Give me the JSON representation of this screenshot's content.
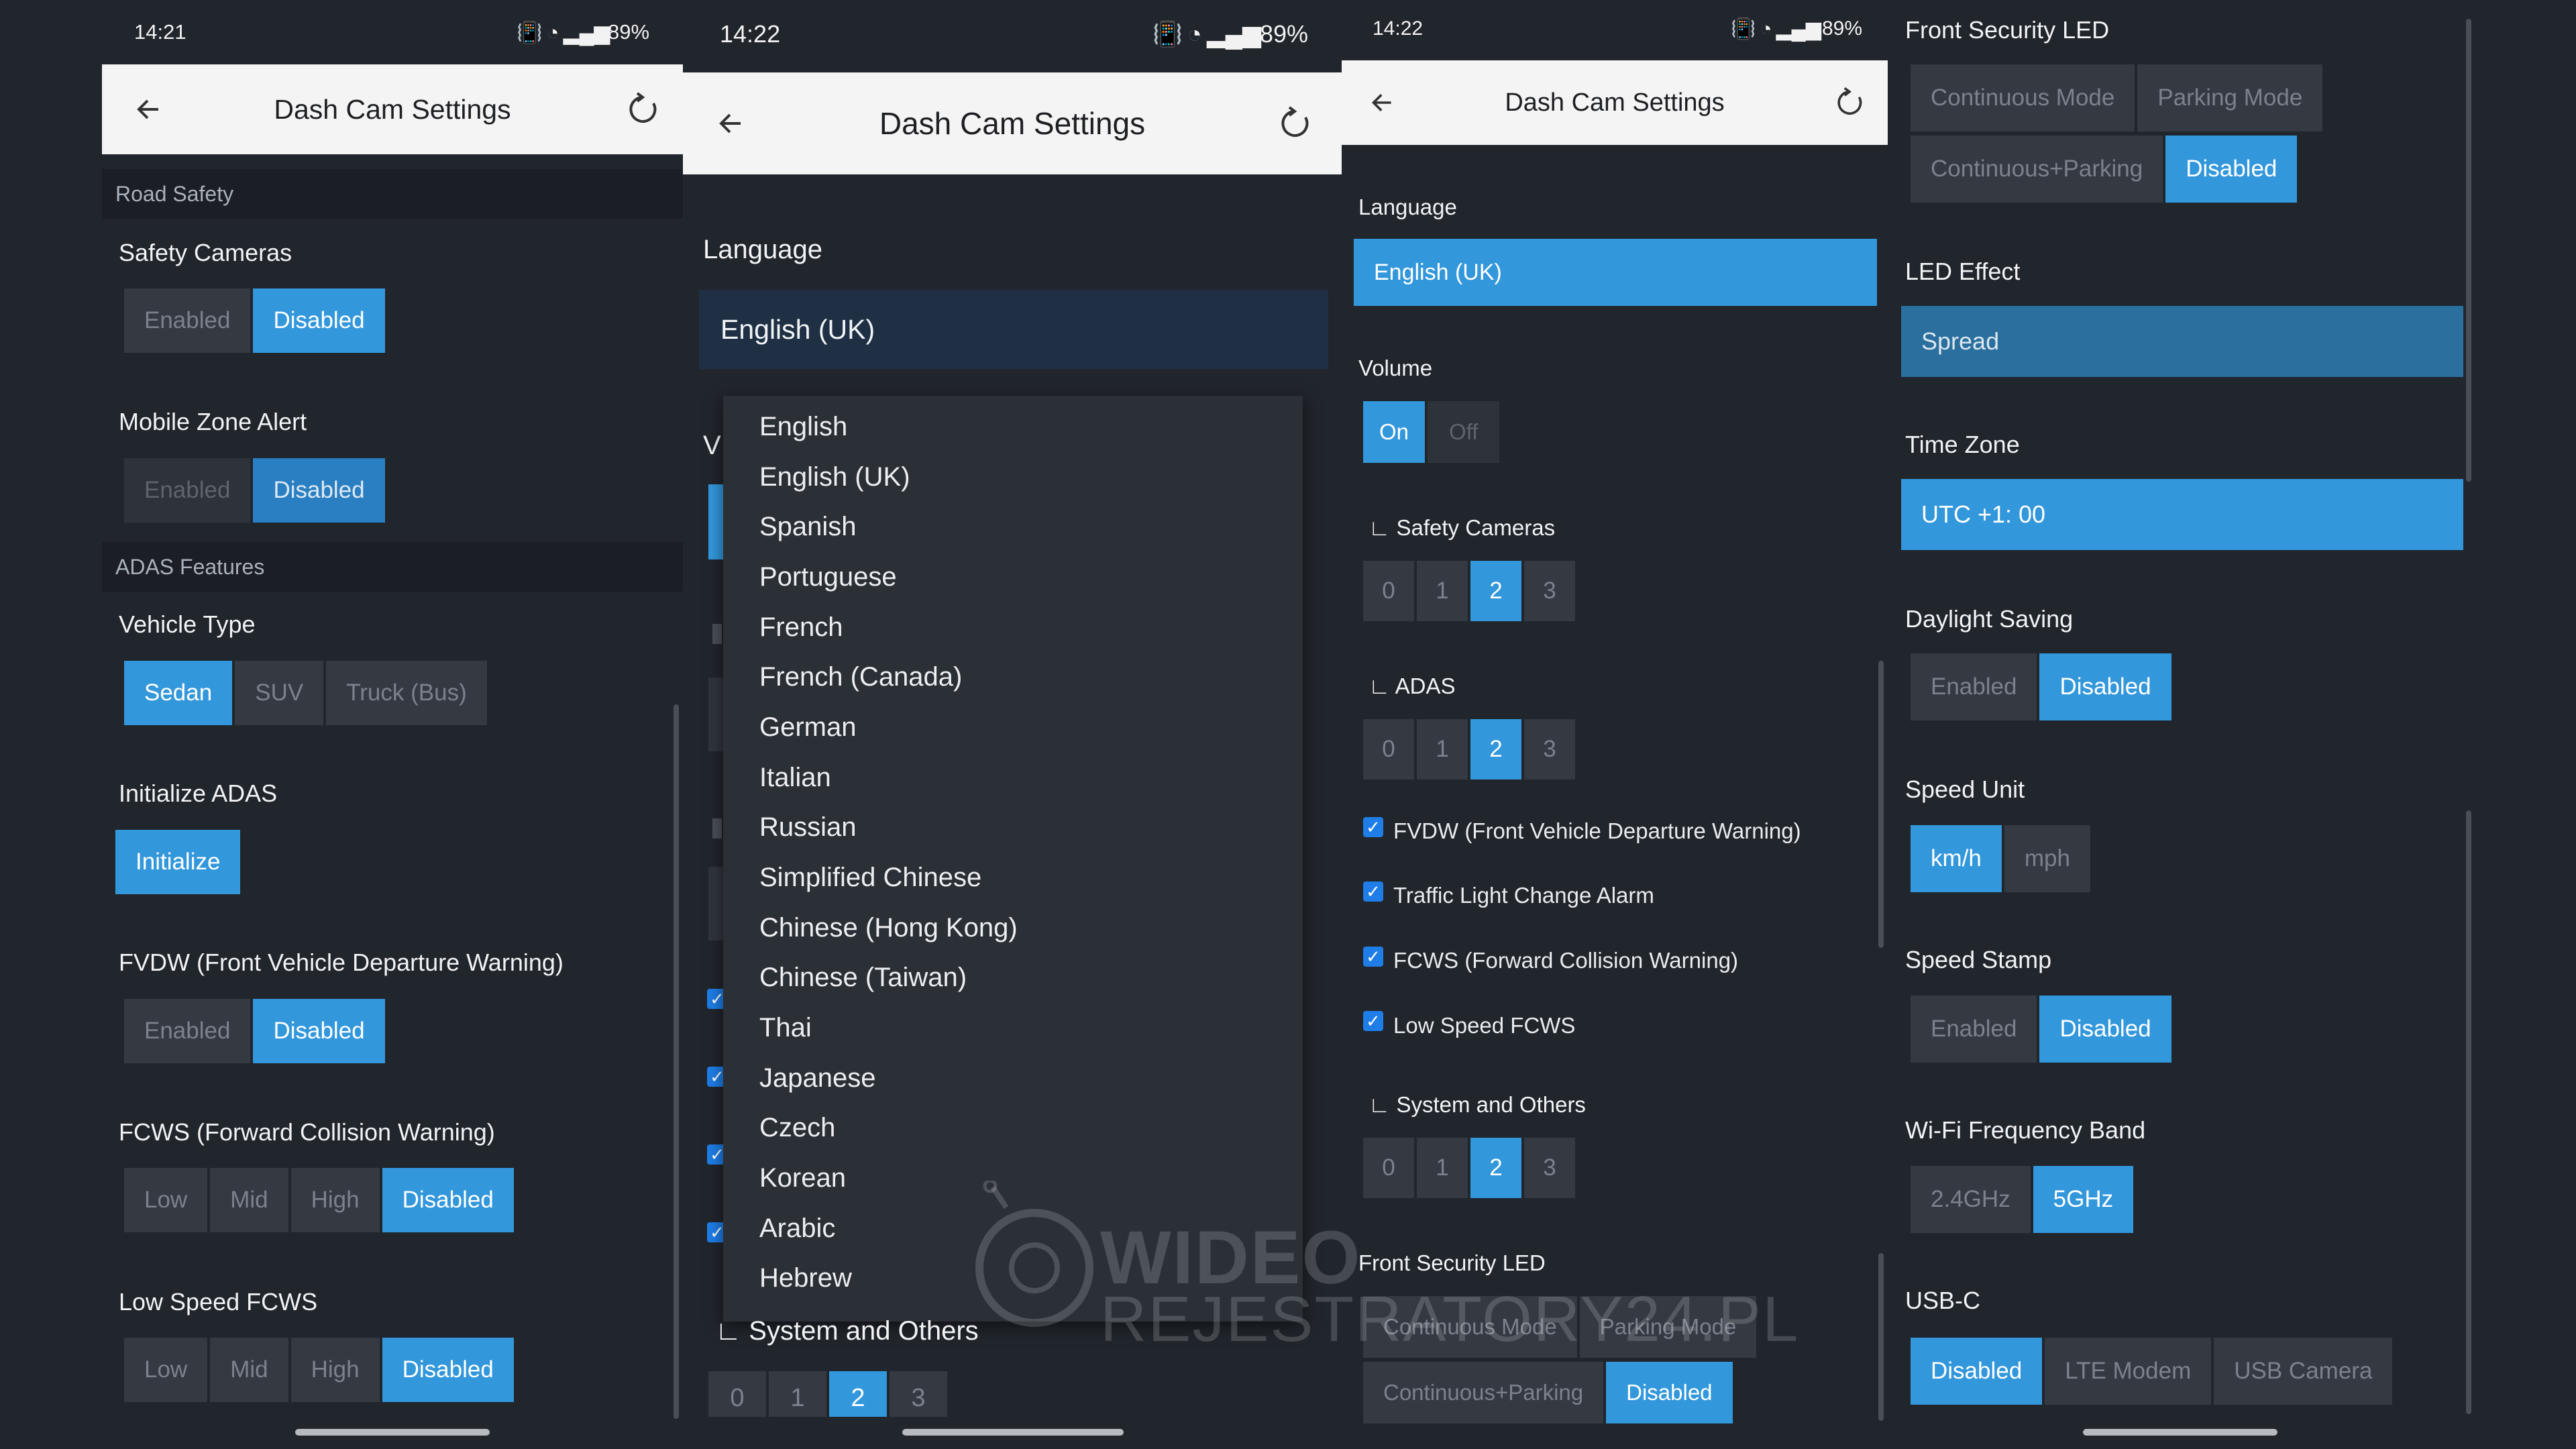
{
  "panel1": {
    "status": {
      "time": "14:21",
      "battery": "89%"
    },
    "title": "Dash Cam Settings",
    "sections": {
      "road_safety": "Road Safety",
      "adas_features": "ADAS Features"
    },
    "safety_cameras": {
      "label": "Safety Cameras",
      "options": [
        "Enabled",
        "Disabled"
      ],
      "selected": "Disabled"
    },
    "mobile_zone_alert": {
      "label": "Mobile Zone Alert",
      "options": [
        "Enabled",
        "Disabled"
      ],
      "selected": "Disabled"
    },
    "vehicle_type": {
      "label": "Vehicle Type",
      "options": [
        "Sedan",
        "SUV",
        "Truck (Bus)"
      ],
      "selected": "Sedan"
    },
    "initialize_adas": {
      "label": "Initialize ADAS",
      "button": "Initialize"
    },
    "fvdw": {
      "label": "FVDW (Front Vehicle Departure Warning)",
      "options": [
        "Enabled",
        "Disabled"
      ],
      "selected": "Disabled"
    },
    "fcws": {
      "label": "FCWS (Forward Collision Warning)",
      "options": [
        "Low",
        "Mid",
        "High",
        "Disabled"
      ],
      "selected": "Disabled"
    },
    "low_speed_fcws": {
      "label": "Low Speed FCWS",
      "options": [
        "Low",
        "Mid",
        "High",
        "Disabled"
      ],
      "selected": "Disabled"
    }
  },
  "panel2": {
    "status": {
      "time": "14:22",
      "battery": "89%"
    },
    "title": "Dash Cam Settings",
    "language_label": "Language",
    "language_value": "English (UK)",
    "partial_label": "V",
    "system_label": "System and Others",
    "system_options": [
      "0",
      "1",
      "2",
      "3"
    ],
    "system_selected": "2",
    "language_options": [
      "English",
      "English (UK)",
      "Spanish",
      "Portuguese",
      "French",
      "French (Canada)",
      "German",
      "Italian",
      "Russian",
      "Simplified Chinese",
      "Chinese (Hong Kong)",
      "Chinese (Taiwan)",
      "Thai",
      "Japanese",
      "Czech",
      "Korean",
      "Arabic",
      "Hebrew"
    ]
  },
  "panel3": {
    "status": {
      "time": "14:22",
      "battery": "89%"
    },
    "title": "Dash Cam Settings",
    "language_label": "Language",
    "language_value": "English (UK)",
    "volume": {
      "label": "Volume",
      "options": [
        "On",
        "Off"
      ],
      "selected": "On"
    },
    "safety_cameras": {
      "label": "Safety Cameras",
      "options": [
        "0",
        "1",
        "2",
        "3"
      ],
      "selected": "2"
    },
    "adas": {
      "label": "ADAS",
      "options": [
        "0",
        "1",
        "2",
        "3"
      ],
      "selected": "2"
    },
    "checks": [
      "FVDW (Front Vehicle Departure Warning)",
      "Traffic Light Change Alarm",
      "FCWS (Forward Collision Warning)",
      "Low Speed FCWS"
    ],
    "system": {
      "label": "System and Others",
      "options": [
        "0",
        "1",
        "2",
        "3"
      ],
      "selected": "2"
    },
    "front_led": {
      "label": "Front Security LED",
      "options": [
        "Continuous Mode",
        "Parking Mode",
        "Continuous+Parking",
        "Disabled"
      ],
      "selected": "Disabled"
    }
  },
  "panel4": {
    "front_led": {
      "label": "Front Security LED",
      "options": [
        "Continuous Mode",
        "Parking Mode",
        "Continuous+Parking",
        "Disabled"
      ],
      "selected": "Disabled"
    },
    "led_effect": {
      "label": "LED Effect",
      "value": "Spread"
    },
    "time_zone": {
      "label": "Time Zone",
      "value": "UTC +1: 00"
    },
    "daylight_saving": {
      "label": "Daylight Saving",
      "options": [
        "Enabled",
        "Disabled"
      ],
      "selected": "Disabled"
    },
    "speed_unit": {
      "label": "Speed Unit",
      "options": [
        "km/h",
        "mph"
      ],
      "selected": "km/h"
    },
    "speed_stamp": {
      "label": "Speed Stamp",
      "options": [
        "Enabled",
        "Disabled"
      ],
      "selected": "Disabled"
    },
    "wifi_band": {
      "label": "Wi-Fi Frequency Band",
      "options": [
        "2.4GHz",
        "5GHz"
      ],
      "selected": "5GHz"
    },
    "usb_c": {
      "label": "USB-C",
      "options": [
        "Disabled",
        "LTE Modem",
        "USB Camera"
      ],
      "selected": "Disabled"
    }
  },
  "watermark": {
    "line1": "WIDEO",
    "line2": "REJESTRATORY24.PL"
  },
  "colors": {
    "accent": "#3397dc",
    "background": "#21252c",
    "header": "#f4f4f4",
    "led_effect": "#2a6f9e"
  }
}
